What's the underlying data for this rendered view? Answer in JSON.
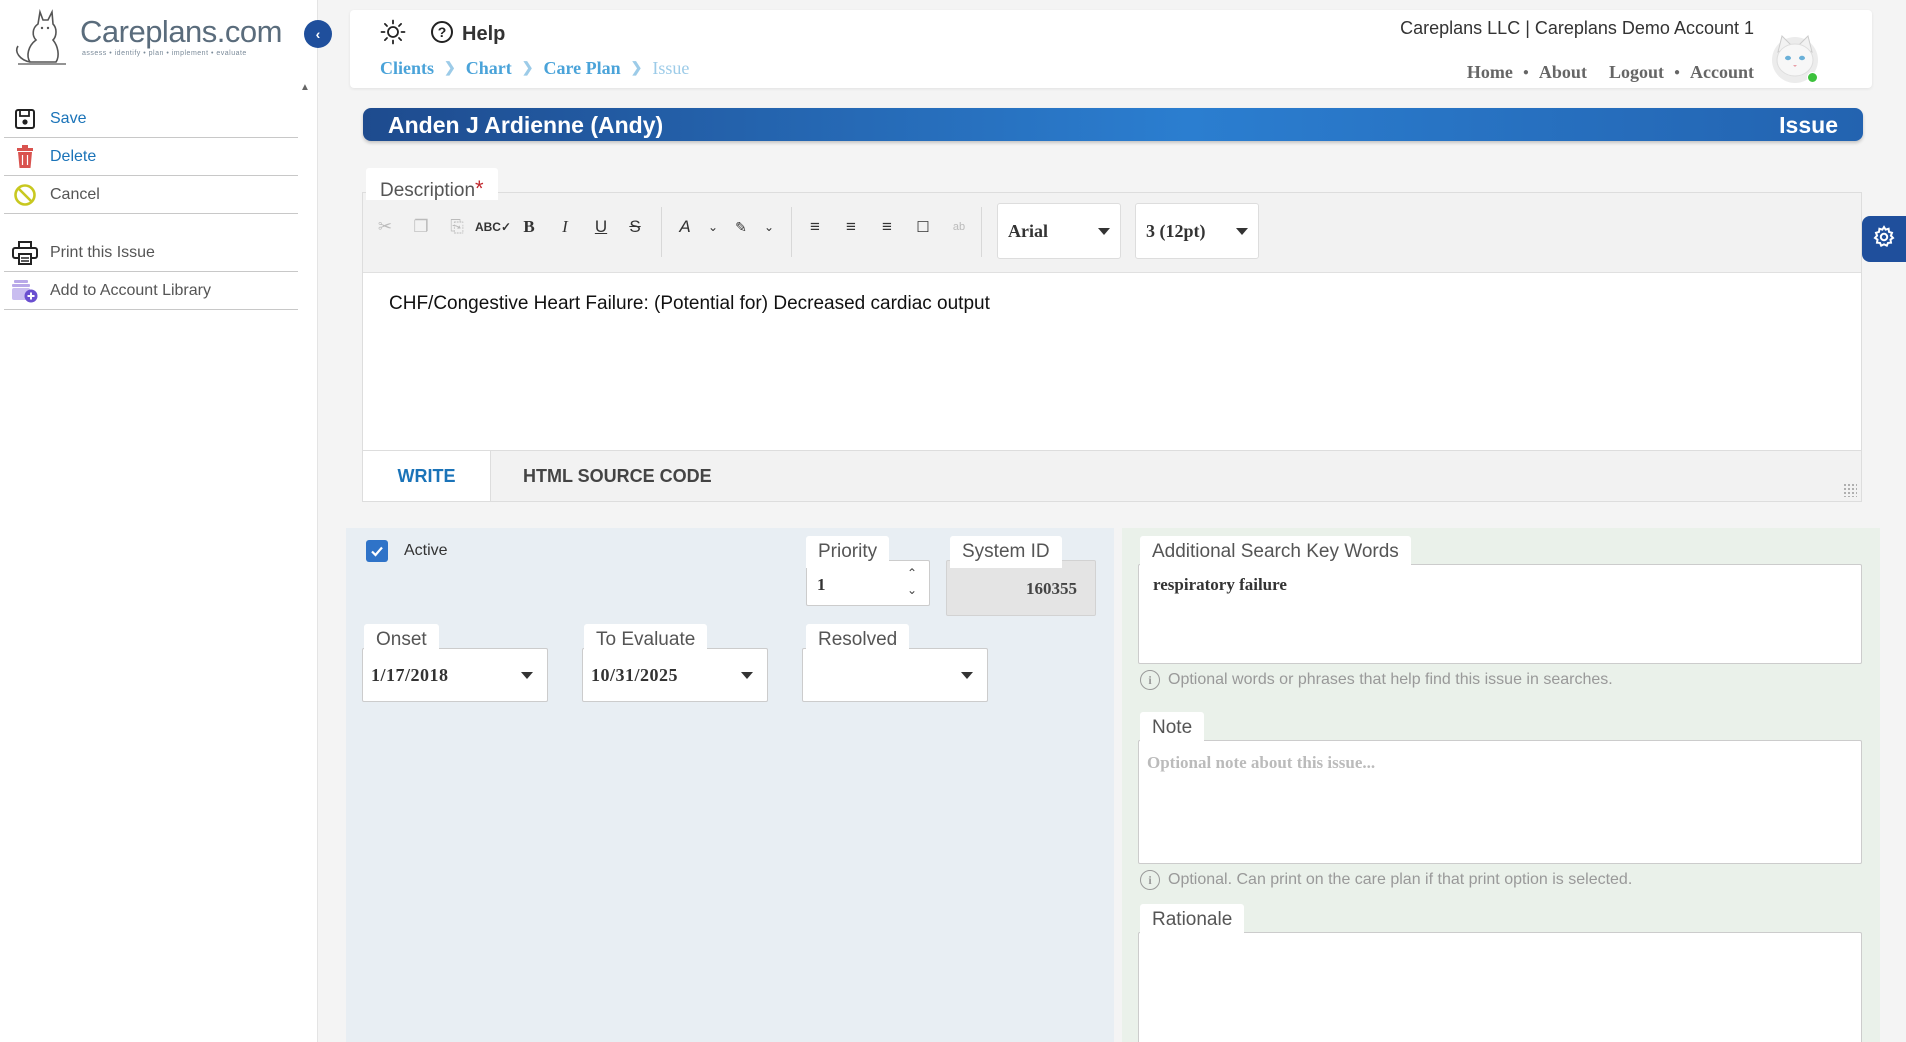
{
  "brand": {
    "name": "Careplans.com",
    "tagline": "assess • identify • plan • implement • evaluate"
  },
  "sidebar": {
    "items": [
      {
        "label": "Save"
      },
      {
        "label": "Delete"
      },
      {
        "label": "Cancel"
      },
      {
        "label": "Print this Issue"
      },
      {
        "label": "Add to Account Library"
      }
    ]
  },
  "header": {
    "help_label": "Help",
    "breadcrumb": [
      "Clients",
      "Chart",
      "Care Plan",
      "Issue"
    ],
    "account_name": "Careplans LLC | Careplans Demo Account 1",
    "nav": [
      "Home",
      "About",
      "Logout",
      "Account"
    ]
  },
  "title_bar": {
    "client_name": "Anden J Ardienne (Andy)",
    "page_type": "Issue"
  },
  "description": {
    "label": "Description",
    "required_mark": "*",
    "content": "CHF/Congestive Heart Failure: (Potential for) Decreased cardiac output",
    "font_family_value": "Arial",
    "font_size_value": "3 (12pt)",
    "tabs": [
      "WRITE",
      "HTML SOURCE CODE"
    ]
  },
  "issue_fields": {
    "active_label": "Active",
    "active_checked": true,
    "priority_label": "Priority",
    "priority_value": "1",
    "system_id_label": "System ID",
    "system_id_value": "160355",
    "onset_label": "Onset",
    "onset_value": "1/17/2018",
    "to_evaluate_label": "To Evaluate",
    "to_evaluate_value": "10/31/2025",
    "resolved_label": "Resolved",
    "resolved_value": ""
  },
  "extra_fields": {
    "keywords_label": "Additional Search Key Words",
    "keywords_value": "respiratory failure",
    "keywords_hint": "Optional words or phrases that help find this issue in searches.",
    "note_label": "Note",
    "note_placeholder": "Optional note about this issue...",
    "note_hint": "Optional. Can print on the care plan if that print option is selected.",
    "rationale_label": "Rationale"
  },
  "colors": {
    "primary": "#1f4f9c",
    "link": "#1a73b8",
    "breadcrumb": "#4aa3d9",
    "left_panel_bg": "#e8eef3",
    "right_panel_bg": "#eaf1ea",
    "delete_red": "#d9534f",
    "cancel_yellow": "#c8c820"
  }
}
